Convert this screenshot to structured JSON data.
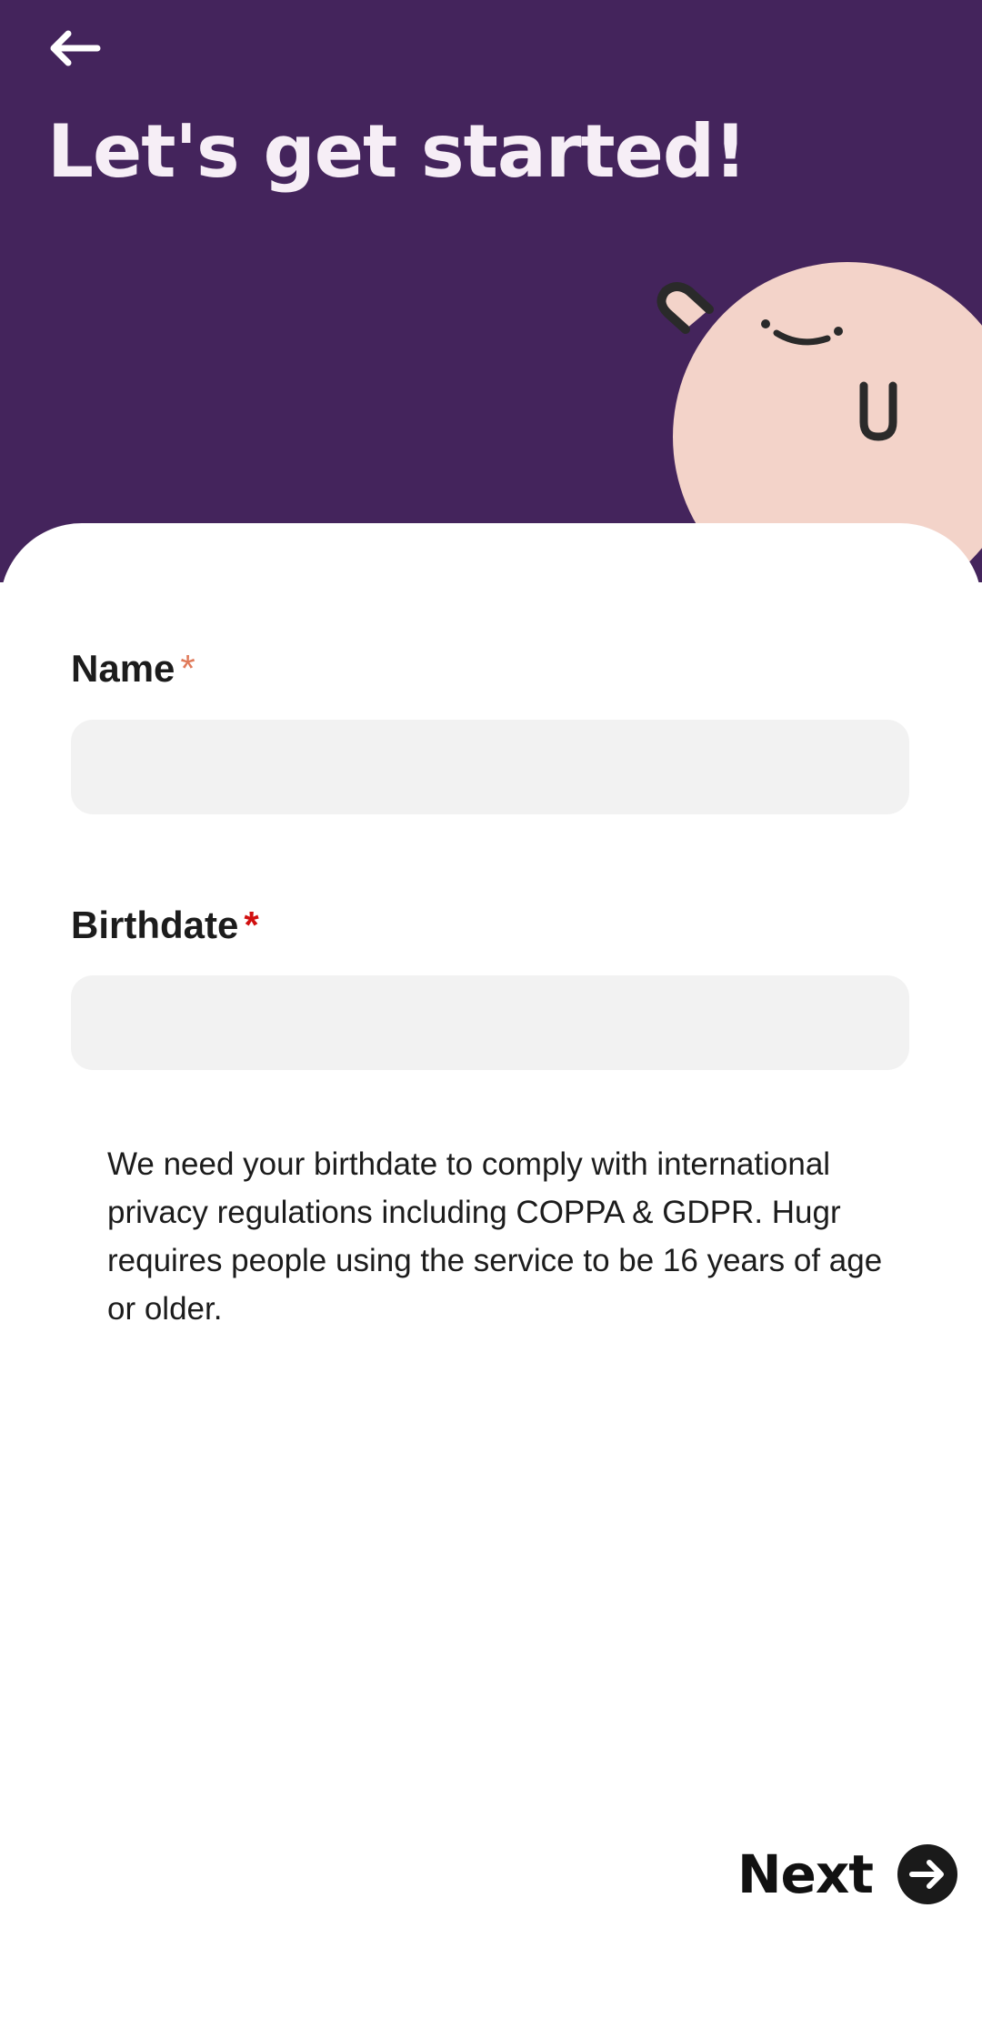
{
  "header": {
    "title": "Let's get started!",
    "background_color": "#44245c",
    "back_icon": "arrow-left-icon",
    "mascot": "smiling-blob-mascot"
  },
  "form": {
    "name_label": "Name",
    "name_required_mark": "*",
    "name_value": "",
    "birthdate_label": "Birthdate",
    "birthdate_required_mark": "*",
    "birthdate_value": "",
    "info_text": "We need your birthdate to comply with international privacy regulations including COPPA & GDPR. Hugr requires people using the service to be 16 years of age or older."
  },
  "footer": {
    "next_label": "Next",
    "next_icon": "arrow-right-circle-icon"
  },
  "colors": {
    "accent_purple": "#44245c",
    "mascot_pink": "#f3d3c9",
    "input_background": "#f2f2f2",
    "required_orange": "#e07a5a",
    "required_red": "#d10f0f"
  }
}
